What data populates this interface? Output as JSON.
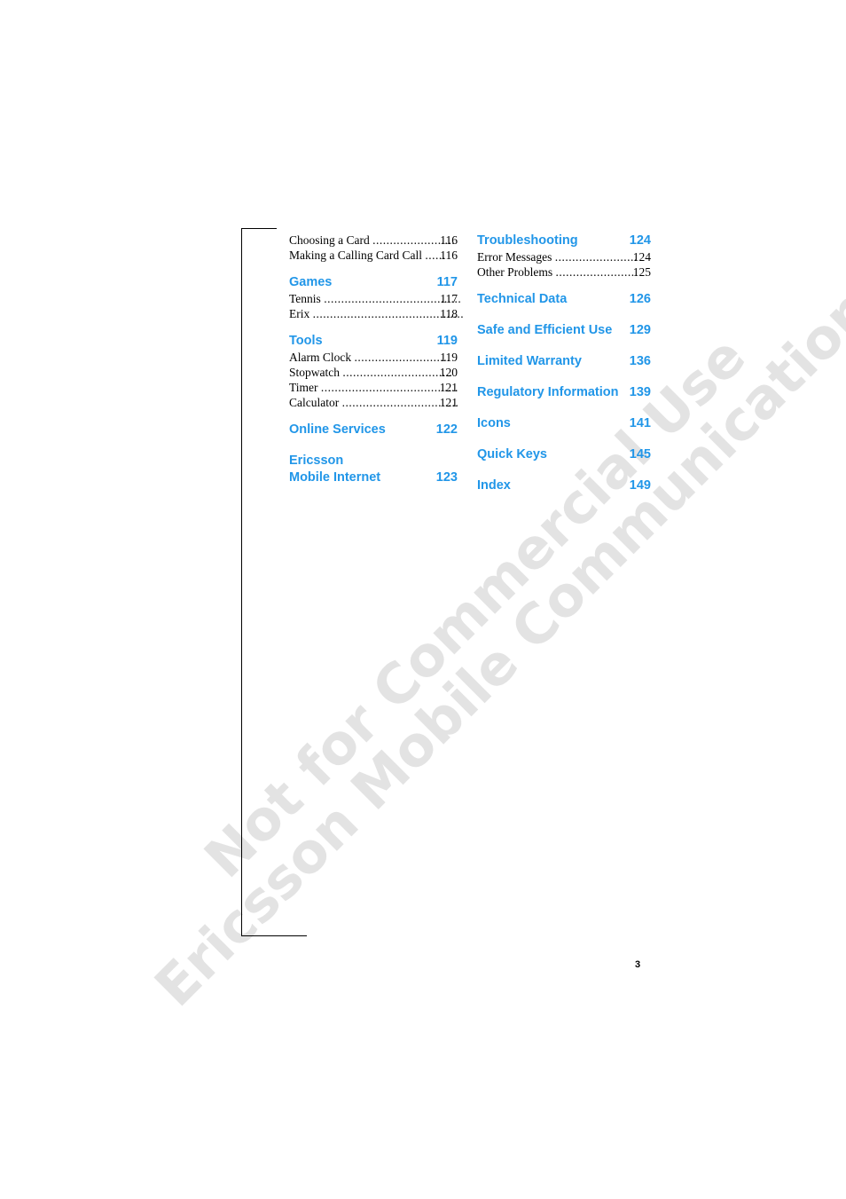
{
  "document": {
    "folio": "3",
    "watermark": {
      "line1": "Not for Commercial Use - Ericsson Mobile Communications AB",
      "line1_a": "Not for Commercial Use",
      "line1_b": "Ericsson Mobile Communications AB"
    }
  },
  "toc": {
    "left_column": [
      {
        "type": "entry",
        "label": "Choosing a Card",
        "dots": "........................",
        "page": "116"
      },
      {
        "type": "entry",
        "label": "Making a Calling Card Call",
        "dots": "......",
        "page": "116"
      },
      {
        "type": "heading",
        "label": "Games",
        "page": "117"
      },
      {
        "type": "entry",
        "label": "Tennis",
        "dots": "........................................",
        "page": "117"
      },
      {
        "type": "entry",
        "label": "Erix",
        "dots": "............................................",
        "page": "118"
      },
      {
        "type": "heading",
        "label": "Tools",
        "page": "119"
      },
      {
        "type": "entry",
        "label": "Alarm Clock",
        "dots": "............................",
        "page": "119"
      },
      {
        "type": "entry",
        "label": "Stopwatch",
        "dots": "................................",
        "page": "120"
      },
      {
        "type": "entry",
        "label": "Timer",
        "dots": "........................................",
        "page": "121"
      },
      {
        "type": "entry",
        "label": "Calculator",
        "dots": "..................................",
        "page": "121"
      },
      {
        "type": "heading",
        "label": "Online Services",
        "page": "122"
      },
      {
        "type": "heading2",
        "label_line1": "Ericsson",
        "label_line2": "Mobile Internet",
        "page": "123"
      }
    ],
    "right_column": [
      {
        "type": "heading",
        "label": "Troubleshooting",
        "page": "124"
      },
      {
        "type": "entry",
        "label": "Error Messages",
        "dots": "........................",
        "page": "124"
      },
      {
        "type": "entry",
        "label": "Other Problems",
        "dots": "........................",
        "page": "125"
      },
      {
        "type": "heading",
        "label": "Technical Data",
        "page": "126"
      },
      {
        "type": "heading",
        "label": "Safe and Efficient Use",
        "page": "129"
      },
      {
        "type": "heading",
        "label": "Limited Warranty",
        "page": "136"
      },
      {
        "type": "heading",
        "label": "Regulatory Information",
        "page": "139"
      },
      {
        "type": "heading",
        "label": "Icons",
        "page": "141"
      },
      {
        "type": "heading",
        "label": "Quick Keys",
        "page": "145"
      },
      {
        "type": "heading",
        "label": "Index",
        "page": "149"
      }
    ]
  }
}
